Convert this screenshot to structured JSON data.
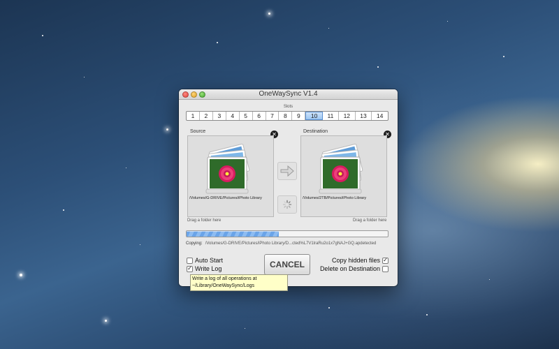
{
  "window": {
    "title": "OneWaySync V1.4"
  },
  "slots": {
    "label": "Slots",
    "items": [
      "1",
      "2",
      "3",
      "4",
      "5",
      "6",
      "7",
      "8",
      "9",
      "10",
      "11",
      "12",
      "13",
      "14"
    ],
    "selected": "10"
  },
  "source": {
    "label": "Source",
    "path": "/Volumes/G-DRIVE/Pictures/iPhoto Library",
    "hint": "Drag a folder here"
  },
  "destination": {
    "label": "Destination",
    "path": "/Volumes/2TB/Pictures/iPhoto Library",
    "hint": "Drag a folder here"
  },
  "progress": {
    "fraction": 0.46
  },
  "copying": {
    "label": "Copying:",
    "path": "/Volumes/G-DRIVE/Pictures/iPhoto Library/D...cted%L7V1lraRu2o1x7gNAJ+GQ.apdetected"
  },
  "options": {
    "auto_start": {
      "label": "Auto Start",
      "checked": false
    },
    "write_log": {
      "label": "Write Log",
      "checked": true
    },
    "copy_hidden": {
      "label": "Copy hidden files",
      "checked": true
    },
    "delete_on_destination": {
      "label": "Delete on Destination",
      "checked": false
    }
  },
  "cancel_label": "CANCEL",
  "tooltip": {
    "text": "Write a log of all operations at ~/Library/OneWaySync/Logs"
  },
  "icons": {
    "close": "close-icon",
    "arrow": "arrow-right-icon",
    "spinner": "spinner-icon",
    "photo": "iphoto-library-icon"
  }
}
